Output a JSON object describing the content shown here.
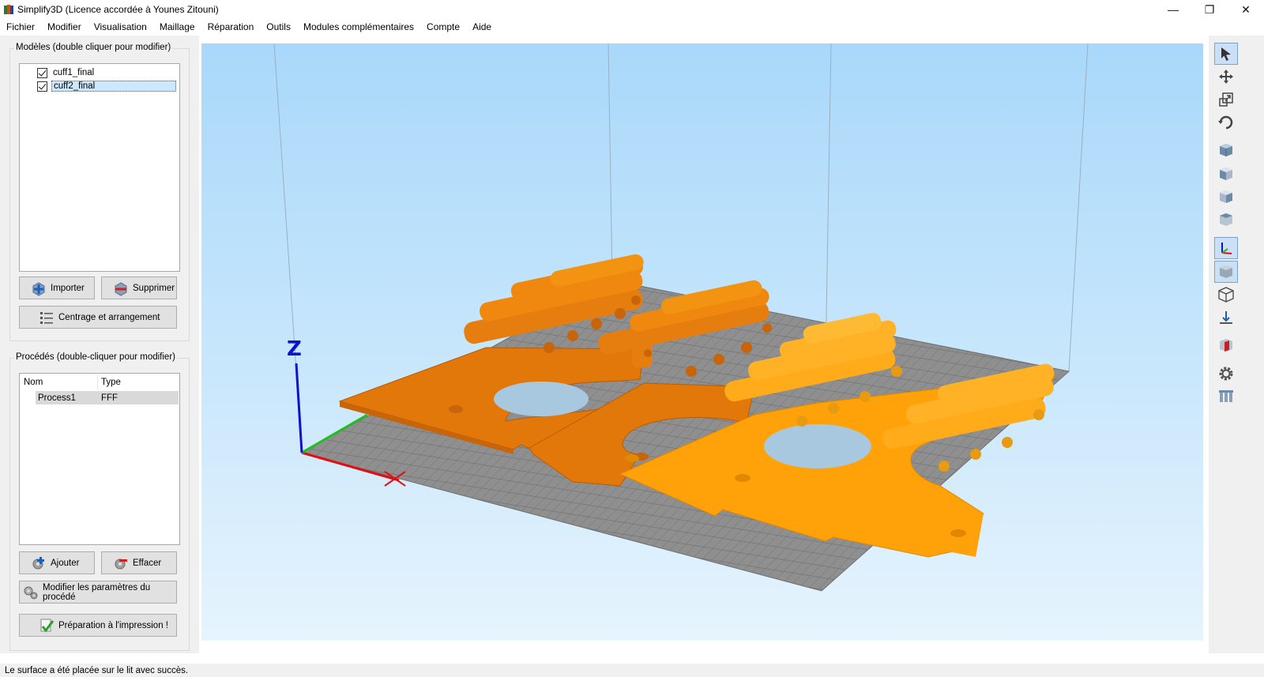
{
  "window": {
    "title": "Simplify3D (Licence accordée à Younes Zitouni)",
    "minimize_glyph": "—",
    "maximize_glyph": "❐",
    "close_glyph": "✕"
  },
  "menu": [
    "Fichier",
    "Modifier",
    "Visualisation",
    "Maillage",
    "Réparation",
    "Outils",
    "Modules complémentaires",
    "Compte",
    "Aide"
  ],
  "models": {
    "title": "Modèles (double cliquer pour modifier)",
    "items": [
      {
        "label": "cuff1_final",
        "checked": true
      },
      {
        "label": "cuff2_final",
        "checked": true,
        "selected": true
      }
    ],
    "import_label": "Importer",
    "delete_label": "Supprimer",
    "center_label": "Centrage et arrangement"
  },
  "processes": {
    "title": "Procédés (double-cliquer pour modifier)",
    "columns": [
      "Nom",
      "Type"
    ],
    "rows": [
      {
        "name": "Process1",
        "type": "FFF"
      }
    ],
    "add_label": "Ajouter",
    "erase_label": "Effacer",
    "edit_label": "Modifier les paramètres du procédé",
    "prepare_label": "Préparation à l'impression !"
  },
  "viewport": {
    "axis_z_label": "Z",
    "colors": {
      "model_dark": "#e2780a",
      "model_light": "#ffa20a",
      "bed": "#8f8f8f",
      "axis_x": "#e01010",
      "axis_y": "#20c020",
      "axis_z": "#1010d0"
    }
  },
  "toolbar": {
    "icons": [
      "select-arrow-icon",
      "move-icon",
      "scale-icon",
      "rotate-icon",
      "view-cube-default-icon",
      "view-cube-front-icon",
      "view-cube-side-icon",
      "view-cube-top-icon",
      "axes-icon",
      "solid-cube-icon",
      "wireframe-cube-icon",
      "bed-icon",
      "cross-section-icon",
      "gear-icon",
      "build-volume-icon"
    ]
  },
  "status": {
    "text": "Le surface a été placée sur le lit avec succès."
  }
}
